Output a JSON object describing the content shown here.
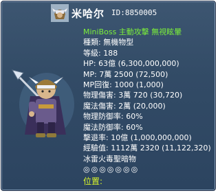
{
  "header": {
    "name": "米哈尔",
    "id_text": "ID:8850005"
  },
  "stats": {
    "tags": "MiniBoss 主動攻擊 無視眩暈",
    "race": "種類: 無機物型",
    "level": "等級: 188",
    "hp": "HP: 63億 (6,300,000,000)",
    "mp": "MP: 7萬 2500 (72,500)",
    "mp_regen": "MP回復: 1000 (1,000)",
    "phys_dmg": "物理傷害: 3萬 720 (30,720)",
    "magic_dmg": "魔法傷害: 2萬 (20,000)",
    "phys_def": "物理防御率: 60%",
    "magic_def": "魔法防御率: 60%",
    "knockback": "擊退率: 10億 (1,000,000,000)",
    "exp": "經驗值: 1112萬 2320 (11,122,320)",
    "elements": "冰雷火毒聖暗物",
    "element_marks": "◎◎◎◎◎◎◎",
    "location": "位置:"
  },
  "colors": {
    "panel": "#334d69",
    "border": "#1f2c44",
    "tag_green": "#7cf03a",
    "location_yellow": "#d9f52a"
  },
  "icons": {
    "avatar": "monster-avatar-icon",
    "portrait": "boss-portrait"
  }
}
